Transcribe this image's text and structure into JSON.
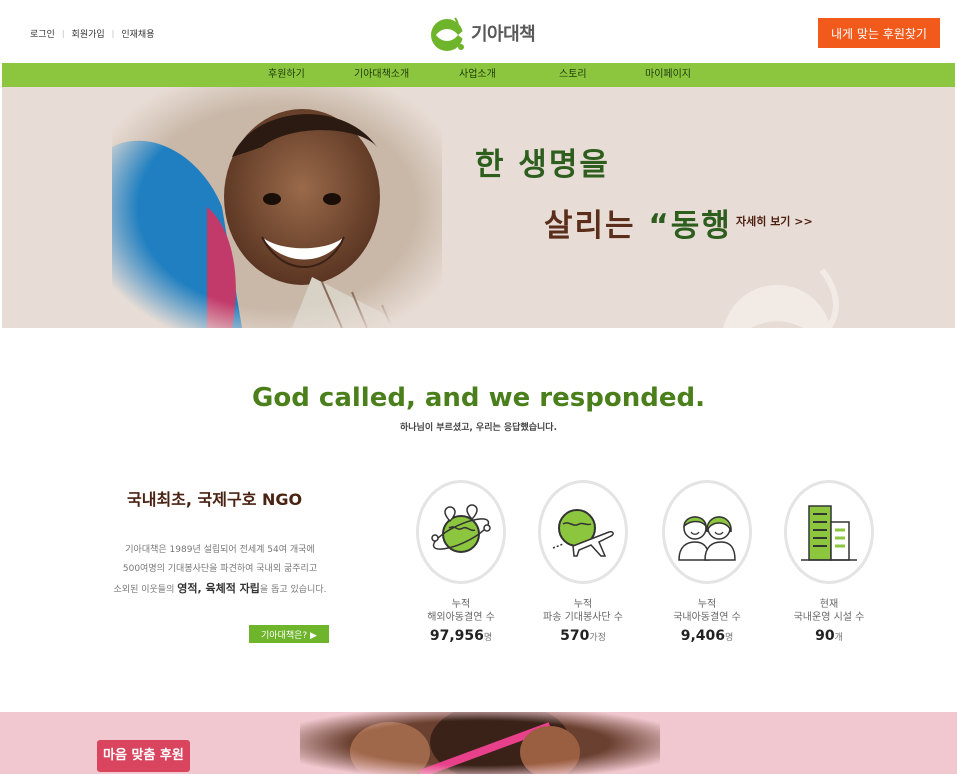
{
  "header": {
    "util_links": [
      "로그인",
      "회원가입",
      "인재채용"
    ],
    "logo_text": "기아대책",
    "cta_label": "내게 맞는 후원찾기"
  },
  "nav": {
    "items": [
      "후원하기",
      "기아대책소개",
      "사업소개",
      "스토리",
      "마이페이지"
    ]
  },
  "hero": {
    "line1": "한 생명을",
    "line2_a": "살리는",
    "line2_quote": "“동행",
    "more_label": "자세히 보기 >>"
  },
  "slogan": {
    "english": "God called, and we responded.",
    "korean": "하나님이 부르셨고, 우리는 응답했습니다."
  },
  "about": {
    "title": "국내최초, 국제구호 NGO",
    "desc_line1": "기아대책은 1989년 설립되어 전세계 54여 개국에",
    "desc_line2": "500여명의 기대봉사단을 파견하여 국내외 굶주리고",
    "desc_line3_pre": "소외된 이웃들의",
    "desc_line3_strong": "영적, 육체적 자립",
    "desc_line3_post": "을 돕고 있습니다.",
    "button_label": "기아대책은? ▶"
  },
  "stats": [
    {
      "icon": "globe-network-icon",
      "line1": "누적",
      "line2": "해외아동결연 수",
      "value": "97,956",
      "unit": "명"
    },
    {
      "icon": "globe-airplane-icon",
      "line1": "누적",
      "line2": "파송 기대봉사단 수",
      "value": "570",
      "unit": "가정"
    },
    {
      "icon": "children-icon",
      "line1": "누적",
      "line2": "국내아동결연 수",
      "value": "9,406",
      "unit": "명"
    },
    {
      "icon": "buildings-icon",
      "line1": "현재",
      "line2": "국내운영 시설 수",
      "value": "90",
      "unit": "개"
    }
  ],
  "bottom": {
    "badge": "마음 맞춤 후원"
  },
  "colors": {
    "accent_green": "#8cc63f",
    "cta_orange": "#f25a1c",
    "slogan_green": "#4a7f1c",
    "badge_red": "#d9455f"
  }
}
